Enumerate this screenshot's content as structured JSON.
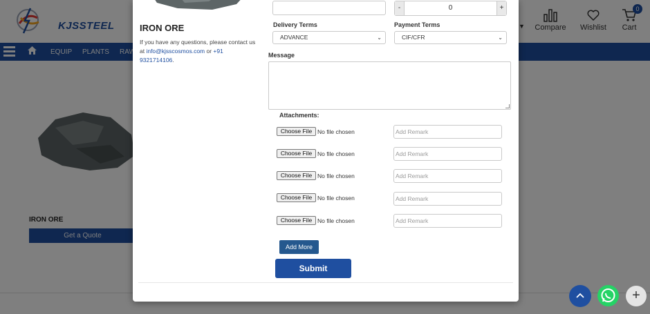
{
  "background": {
    "logo_text": "KJSSTEEL",
    "header_icons": [
      {
        "label": "Compare",
        "icon": "compare-icon"
      },
      {
        "label": "Wishlist",
        "icon": "heart-icon"
      },
      {
        "label": "Cart",
        "icon": "cart-icon",
        "badge": "0"
      }
    ],
    "nav_items": [
      "EQUIP",
      "PLANTS",
      "RAW"
    ],
    "product_name": "IRON ORE",
    "quote_button": "Get a Quote"
  },
  "modal": {
    "product_title": "IRON ORE",
    "info_text": "If you have any questions, please contact us at ",
    "info_email": "info@kjsscosmos.com",
    "info_or": " or ",
    "info_phone": "+91 9321714106",
    "info_end": ".",
    "top_input_value": "",
    "quantity": {
      "minus": "-",
      "value": "0",
      "plus": "+"
    },
    "delivery_terms": {
      "label": "Delivery Terms",
      "value": "ADVANCE"
    },
    "payment_terms": {
      "label": "Payment Terms",
      "value": "CIF/CFR"
    },
    "message_label": "Message",
    "attachments_label": "Attachments:",
    "attachments": [
      {
        "button": "Choose File",
        "status": "No file chosen",
        "remark_placeholder": "Add Remark"
      },
      {
        "button": "Choose File",
        "status": "No file chosen",
        "remark_placeholder": "Add Remark"
      },
      {
        "button": "Choose File",
        "status": "No file chosen",
        "remark_placeholder": "Add Remark"
      },
      {
        "button": "Choose File",
        "status": "No file chosen",
        "remark_placeholder": "Add Remark"
      },
      {
        "button": "Choose File",
        "status": "No file chosen",
        "remark_placeholder": "Add Remark"
      }
    ],
    "add_more_label": "Add More",
    "submit_label": "Submit"
  },
  "floating_buttons": {
    "plus": "+"
  },
  "colors": {
    "brand": "#1f4fa0",
    "whatsapp": "#25d366"
  }
}
